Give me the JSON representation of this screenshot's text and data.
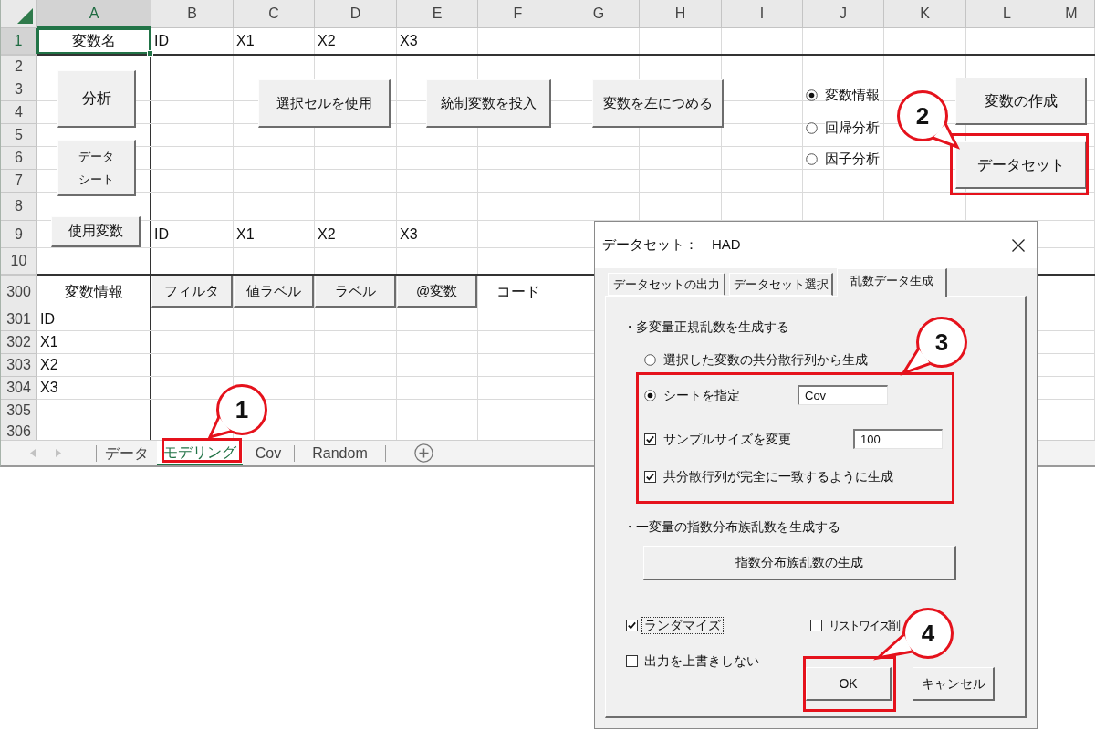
{
  "sheet": {
    "columns": [
      {
        "label": "A",
        "selected": true
      },
      {
        "label": "B",
        "selected": false
      },
      {
        "label": "C",
        "selected": false
      },
      {
        "label": "D",
        "selected": false
      },
      {
        "label": "E",
        "selected": false
      },
      {
        "label": "F",
        "selected": false
      },
      {
        "label": "G",
        "selected": false
      },
      {
        "label": "H",
        "selected": false
      },
      {
        "label": "I",
        "selected": false
      },
      {
        "label": "J",
        "selected": false
      },
      {
        "label": "K",
        "selected": false
      },
      {
        "label": "L",
        "selected": false
      },
      {
        "label": "M",
        "selected": false
      }
    ],
    "rows": [
      {
        "number": "1",
        "selected": true,
        "cells": [
          {
            "kind": "heading",
            "text": "変数名"
          },
          {
            "kind": "text",
            "text": "ID"
          },
          {
            "kind": "text",
            "text": "X1"
          },
          {
            "kind": "text",
            "text": "X2"
          },
          {
            "kind": "text",
            "text": "X3"
          }
        ]
      },
      {
        "number": "2",
        "selected": false
      },
      {
        "number": "3",
        "selected": false
      },
      {
        "number": "4",
        "selected": false
      },
      {
        "number": "5",
        "selected": false
      },
      {
        "number": "6",
        "selected": false
      },
      {
        "number": "7",
        "selected": false
      },
      {
        "number": "8",
        "selected": false
      },
      {
        "number": "9",
        "selected": false,
        "cells": [
          null,
          {
            "kind": "text",
            "text": "ID"
          },
          {
            "kind": "text",
            "text": "X1"
          },
          {
            "kind": "text",
            "text": "X2"
          },
          {
            "kind": "text",
            "text": "X3"
          }
        ]
      },
      {
        "number": "10",
        "selected": false
      },
      {
        "number": "300",
        "selected": false,
        "cells": [
          {
            "kind": "heading",
            "text": "変数情報"
          },
          {
            "kind": "button",
            "text": "フィルタ"
          },
          {
            "kind": "button",
            "text": "値ラベル"
          },
          {
            "kind": "button",
            "text": "ラベル"
          },
          {
            "kind": "button",
            "text": "@変数"
          },
          {
            "kind": "heading",
            "text": "コード"
          }
        ]
      },
      {
        "number": "301",
        "selected": false,
        "cells": [
          {
            "kind": "text",
            "text": "ID"
          }
        ]
      },
      {
        "number": "302",
        "selected": false,
        "cells": [
          {
            "kind": "text",
            "text": "X1"
          }
        ]
      },
      {
        "number": "303",
        "selected": false,
        "cells": [
          {
            "kind": "text",
            "text": "X2"
          }
        ]
      },
      {
        "number": "304",
        "selected": false,
        "cells": [
          {
            "kind": "text",
            "text": "X3"
          }
        ]
      },
      {
        "number": "305",
        "selected": false
      },
      {
        "number": "306",
        "selected": false
      }
    ],
    "buttons": [
      "分析",
      "データシート",
      "使用変数",
      "選択セルを使用",
      "統制変数を投入",
      "変数を左につめる",
      "変数の作成",
      "データセット"
    ],
    "analysis_options": [
      {
        "label": "変数情報",
        "selected": true
      },
      {
        "label": "回帰分析",
        "selected": false
      },
      {
        "label": "因子分析",
        "selected": false
      }
    ],
    "sheet_tabs": [
      {
        "label": "データ",
        "selected": false
      },
      {
        "label": "モデリング",
        "selected": true
      },
      {
        "label": "Cov",
        "selected": false
      },
      {
        "label": "Random",
        "selected": false
      }
    ]
  },
  "dialog": {
    "title": "データセット：　HAD",
    "tabs": [
      {
        "label": "データセットの出力",
        "selected": false
      },
      {
        "label": "データセット選択",
        "selected": false
      },
      {
        "label": "乱数データ生成",
        "selected": true
      }
    ],
    "sections": [
      {
        "heading": "・多変量正規乱数を生成する",
        "items": [
          {
            "kind": "radio",
            "label": "選択した変数の共分散行列から生成",
            "selected": false
          },
          {
            "kind": "radio",
            "label": "シートを指定",
            "selected": true,
            "value": "Cov"
          },
          {
            "kind": "checkbox",
            "label": "サンプルサイズを変更",
            "checked": true,
            "value": "100"
          },
          {
            "kind": "checkbox",
            "label": "共分散行列が完全に一致するように生成",
            "checked": true
          }
        ]
      },
      {
        "heading": "・一変量の指数分布族乱数を生成する",
        "items": [
          {
            "kind": "button",
            "label": "指数分布族乱数の生成"
          }
        ]
      }
    ],
    "options": [
      {
        "label": "ランダマイズ",
        "checked": true,
        "focused": true
      },
      {
        "label": "リストワイズ削",
        "checked": false,
        "focused": false
      },
      {
        "label": "出力を上書きしない",
        "checked": false,
        "focused": false
      }
    ],
    "buttons": [
      "OK",
      "キャンセル"
    ]
  },
  "callouts": [
    "1",
    "2",
    "3",
    "4"
  ]
}
